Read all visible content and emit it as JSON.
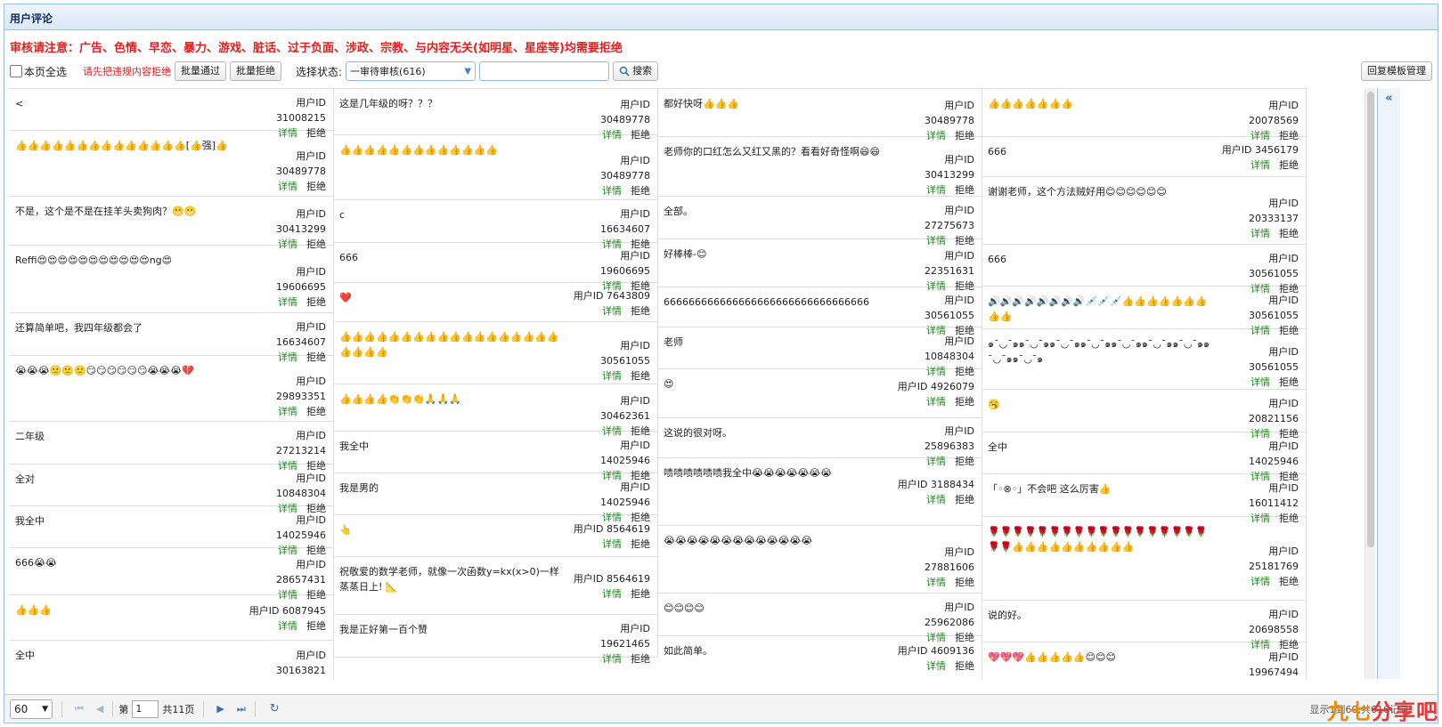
{
  "panel": {
    "title": "用户评论"
  },
  "notice": "审核请注意：广告、色情、早恋、暴力、游戏、脏话、过于负面、涉政、宗教、与内容无关(如明星、星座等)均需要拒绝",
  "toolbar": {
    "select_all": "本页全选",
    "warn": "请先把违规内容拒绝",
    "batch_pass": "批量通过",
    "batch_reject": "批量拒绝",
    "status_label": "选择状态:",
    "status_value": "一审待审核(616)",
    "search_value": "",
    "search_btn": "搜索",
    "template_btn": "回复模板管理"
  },
  "labels": {
    "uid_prefix": "用户ID",
    "detail": "详情",
    "reject": "拒绝"
  },
  "columns": [
    [
      {
        "text": "<",
        "uid": "31008215"
      },
      {
        "text": "👍👍👍👍👍👍👍👍👍👍👍👍👍👍[👍强]👍",
        "uid": "30489778"
      },
      {
        "text": "不是，这个是不是在挂羊头卖狗肉？😬😬",
        "uid": "30413299"
      },
      {
        "text": "Reffi😍😍😍😍😍😍😍😍😍😍😍ng😍",
        "uid": "19606695"
      },
      {
        "text": "还算简单吧，我四年级都会了",
        "uid": "16634607"
      },
      {
        "text": "😭😭😭🙁🙁🙁😏😏😏😏😏😏😭😭😭💔",
        "uid": "29893351"
      },
      {
        "text": "二年级",
        "uid": "27213214"
      },
      {
        "text": "全对",
        "uid": "10848304"
      },
      {
        "text": "我全中",
        "uid": "14025946"
      },
      {
        "text": "666😭😭",
        "uid": "28657431"
      },
      {
        "text": "👍👍👍",
        "uid": "6087945"
      },
      {
        "text": "全中",
        "uid": "30163821"
      }
    ],
    [
      {
        "text": "这是几年级的呀？？？",
        "uid": "30489778"
      },
      {
        "text": "👍👍👍👍👍👍👍👍👍👍👍👍👍",
        "uid": "30489778"
      },
      {
        "text": "c",
        "uid": "16634607"
      },
      {
        "text": "666",
        "uid": "19606695"
      },
      {
        "text": "❤️",
        "uid": "7643809"
      },
      {
        "text": "👍👍👍👍👍👍👍👍👍👍👍👍👍👍👍👍👍👍👍👍👍👍",
        "uid": "30561055"
      },
      {
        "text": "👍👍👍👍👏👏👏🙏🙏🙏",
        "uid": "30462361"
      },
      {
        "text": "我全中",
        "uid": "14025946"
      },
      {
        "text": "我是男的",
        "uid": "14025946"
      },
      {
        "text": "👆",
        "uid": "8564619"
      },
      {
        "text": "祝敬爱的数学老师，就像一次函数y=kx(x>0)一样 蒸蒸日上! 📐",
        "uid": "8564619"
      },
      {
        "text": "我是正好第一百个赞",
        "uid": "19621465"
      }
    ],
    [
      {
        "text": "都好快呀👍👍👍",
        "uid": "30489778"
      },
      {
        "text": "老师你的口红怎么又红又黑的？看看好奇怪啊😄😄",
        "uid": "30413299"
      },
      {
        "text": "全部。",
        "uid": "27275673"
      },
      {
        "text": "好棒棒-😊",
        "uid": "22351631"
      },
      {
        "text": "666666666666666666666666666666666",
        "uid": "30561055"
      },
      {
        "text": "老师",
        "uid": "10848304"
      },
      {
        "text": "😍",
        "uid": "4926079"
      },
      {
        "text": "这说的很对呀。",
        "uid": "25896383"
      },
      {
        "text": "啧啧啧啧啧啧我全中😭😭😭😭😭😭😭",
        "uid": "3188434"
      },
      {
        "text": "😭😭😭😭😭😭😭😭😭😭😭😭😭",
        "uid": "27881606"
      },
      {
        "text": "😊😊😊😊",
        "uid": "25962086"
      },
      {
        "text": "如此简单。",
        "uid": "4609136"
      }
    ],
    [
      {
        "text": "👍👍👍👍👍👍👍",
        "uid": "20078569"
      },
      {
        "text": "666",
        "uid": "3456179"
      },
      {
        "text": "谢谢老师，这个方法贼好用😊😊😊😊😊😊",
        "uid": "20333137"
      },
      {
        "text": "666",
        "uid": "30561055"
      },
      {
        "text": "🔊🔊🔊🔊🔊🔊🔊🔊💉💉💉👍👍👍👍👍👍👍👍👍",
        "uid": "30561055"
      },
      {
        "text": "๑¯◡¯๑๑¯◡¯๑๑¯◡¯๑๑¯◡¯๑๑¯◡¯๑๑¯◡¯๑๑¯◡¯๑๑¯◡¯๑๑¯◡¯๑",
        "uid": "30561055"
      },
      {
        "text": "🥱",
        "uid": "20821156"
      },
      {
        "text": "全中",
        "uid": "14025946"
      },
      {
        "text": "「◦⊗◦」不会吧 这么厉害👍",
        "uid": "16011412"
      },
      {
        "text": "🌹🌹🌹🌹🌹🌹🌹🌹🌹🌹🌹🌹🌹🌹🌹🌹🌹🌹🌹🌹👍👍👍👍👍👍👍👍👍👍",
        "uid": "25181769"
      },
      {
        "text": "说的好。",
        "uid": "20698558"
      },
      {
        "text": "💖💖💖👍👍👍👍👍😊😊😊",
        "uid": "19967494"
      }
    ]
  ],
  "pager": {
    "page_size": "60",
    "page_prefix": "第",
    "page_value": "1",
    "page_total": "共11页",
    "info": "显示1到60,共616记录"
  },
  "watermark": {
    "part1": "九七",
    "part2": "分享吧"
  }
}
